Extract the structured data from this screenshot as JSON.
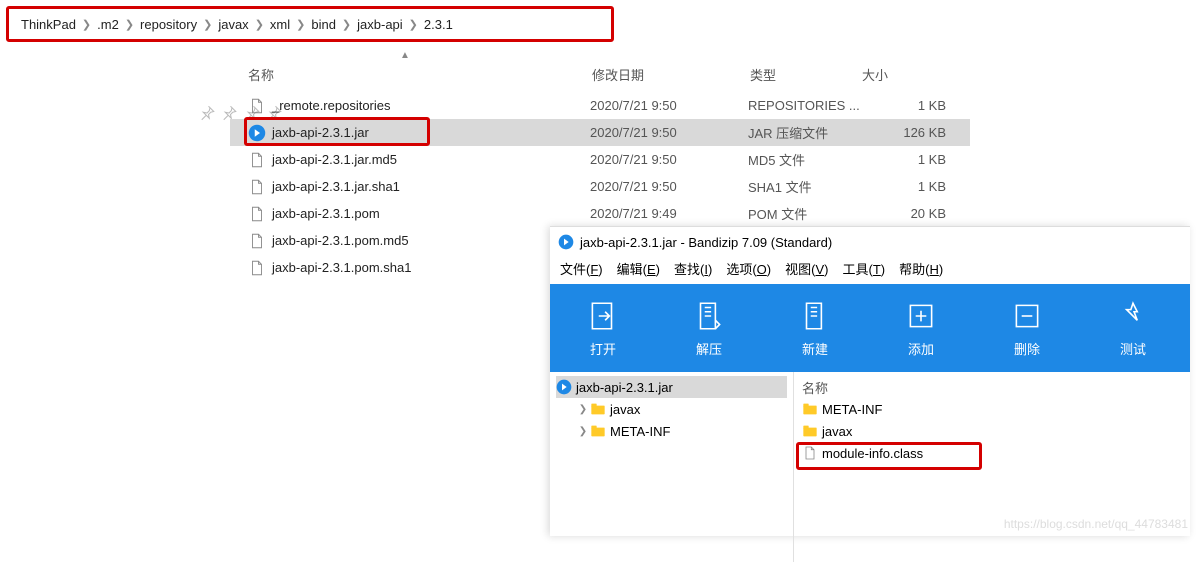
{
  "breadcrumb": [
    "ThinkPad",
    ".m2",
    "repository",
    "javax",
    "xml",
    "bind",
    "jaxb-api",
    "2.3.1"
  ],
  "columns": {
    "name": "名称",
    "date": "修改日期",
    "type": "类型",
    "size": "大小"
  },
  "files": [
    {
      "icon": "doc",
      "name": "_remote.repositories",
      "date": "2020/7/21 9:50",
      "type": "REPOSITORIES ...",
      "size": "1 KB",
      "sel": false,
      "hi": false
    },
    {
      "icon": "exec",
      "name": "jaxb-api-2.3.1.jar",
      "date": "2020/7/21 9:50",
      "type": "JAR 压缩文件",
      "size": "126 KB",
      "sel": true,
      "hi": true
    },
    {
      "icon": "doc",
      "name": "jaxb-api-2.3.1.jar.md5",
      "date": "2020/7/21 9:50",
      "type": "MD5 文件",
      "size": "1 KB",
      "sel": false,
      "hi": false
    },
    {
      "icon": "doc",
      "name": "jaxb-api-2.3.1.jar.sha1",
      "date": "2020/7/21 9:50",
      "type": "SHA1 文件",
      "size": "1 KB",
      "sel": false,
      "hi": false
    },
    {
      "icon": "doc",
      "name": "jaxb-api-2.3.1.pom",
      "date": "2020/7/21 9:49",
      "type": "POM 文件",
      "size": "20 KB",
      "sel": false,
      "hi": false
    },
    {
      "icon": "doc",
      "name": "jaxb-api-2.3.1.pom.md5",
      "date": "",
      "type": "",
      "size": "",
      "sel": false,
      "hi": false
    },
    {
      "icon": "doc",
      "name": "jaxb-api-2.3.1.pom.sha1",
      "date": "",
      "type": "",
      "size": "",
      "sel": false,
      "hi": false
    }
  ],
  "bz": {
    "title": "jaxb-api-2.3.1.jar - Bandizip 7.09 (Standard)",
    "menu": [
      "文件(F)",
      "编辑(E)",
      "查找(I)",
      "选项(O)",
      "视图(V)",
      "工具(T)",
      "帮助(H)"
    ],
    "toolbar": [
      "打开",
      "解压",
      "新建",
      "添加",
      "删除",
      "测试"
    ],
    "tree_root": "jaxb-api-2.3.1.jar",
    "tree_children": [
      "javax",
      "META-INF"
    ],
    "right_header": "名称",
    "right_items": [
      {
        "icon": "folder",
        "name": "META-INF"
      },
      {
        "icon": "folder",
        "name": "javax"
      },
      {
        "icon": "doc",
        "name": "module-info.class"
      }
    ]
  },
  "watermark": "https://blog.csdn.net/qq_44783481"
}
